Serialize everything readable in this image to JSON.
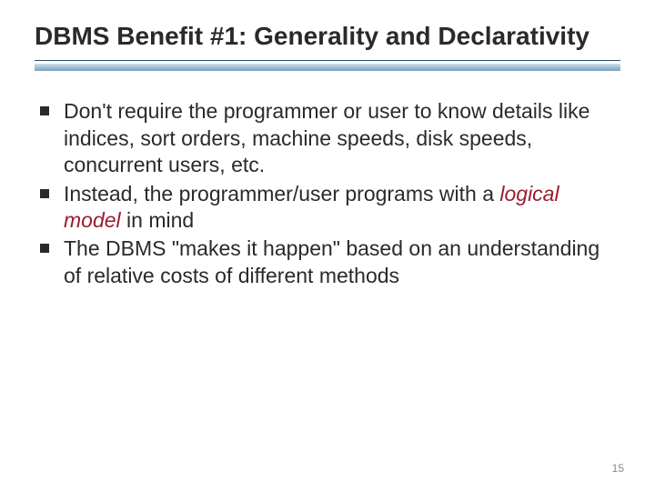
{
  "slide": {
    "title": "DBMS Benefit #1: Generality and Declarativity",
    "bullets": [
      {
        "text": "Don't require the programmer or user to know details like indices, sort orders, machine speeds, disk speeds, concurrent users, etc."
      },
      {
        "pre": "Instead, the programmer/user programs with a ",
        "em": "logical model",
        "post": " in mind"
      },
      {
        "text": "The DBMS \"makes it happen\" based on an understanding of relative costs of different methods"
      }
    ],
    "page_number": "15"
  }
}
